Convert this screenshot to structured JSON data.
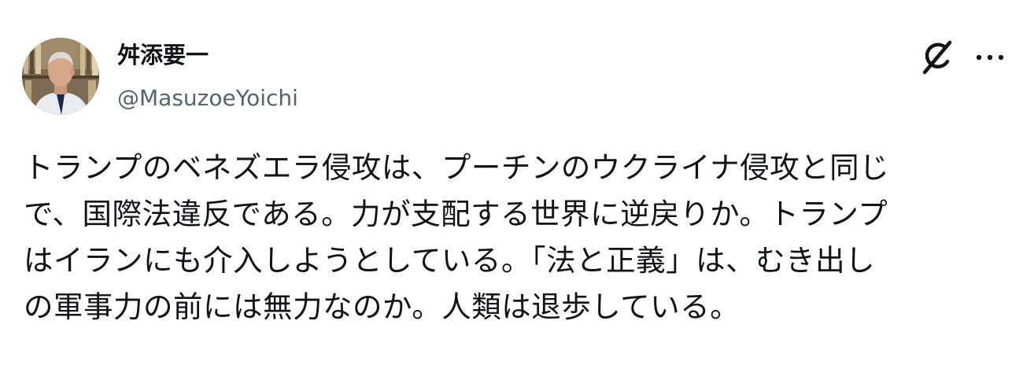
{
  "author": {
    "display_name": "舛添要一",
    "handle": "@MasuzoeYoichi"
  },
  "icons": {
    "grok": "grok-icon",
    "more": "more-options-icon"
  },
  "tweet": {
    "text_lines": [
      "トランプのベネズエラ侵攻は、プーチンのウクライナ侵攻と同じ",
      "で、国際法違反である。力が支配する世界に逆戻りか。トランプ",
      "はイランにも介入しようとしている。「法と正義」は、むき出し",
      "の軍事力の前には無力なのか。人類は退歩している。"
    ]
  },
  "colors": {
    "text_primary": "#0f1419",
    "text_secondary": "#536471",
    "background": "#ffffff"
  }
}
